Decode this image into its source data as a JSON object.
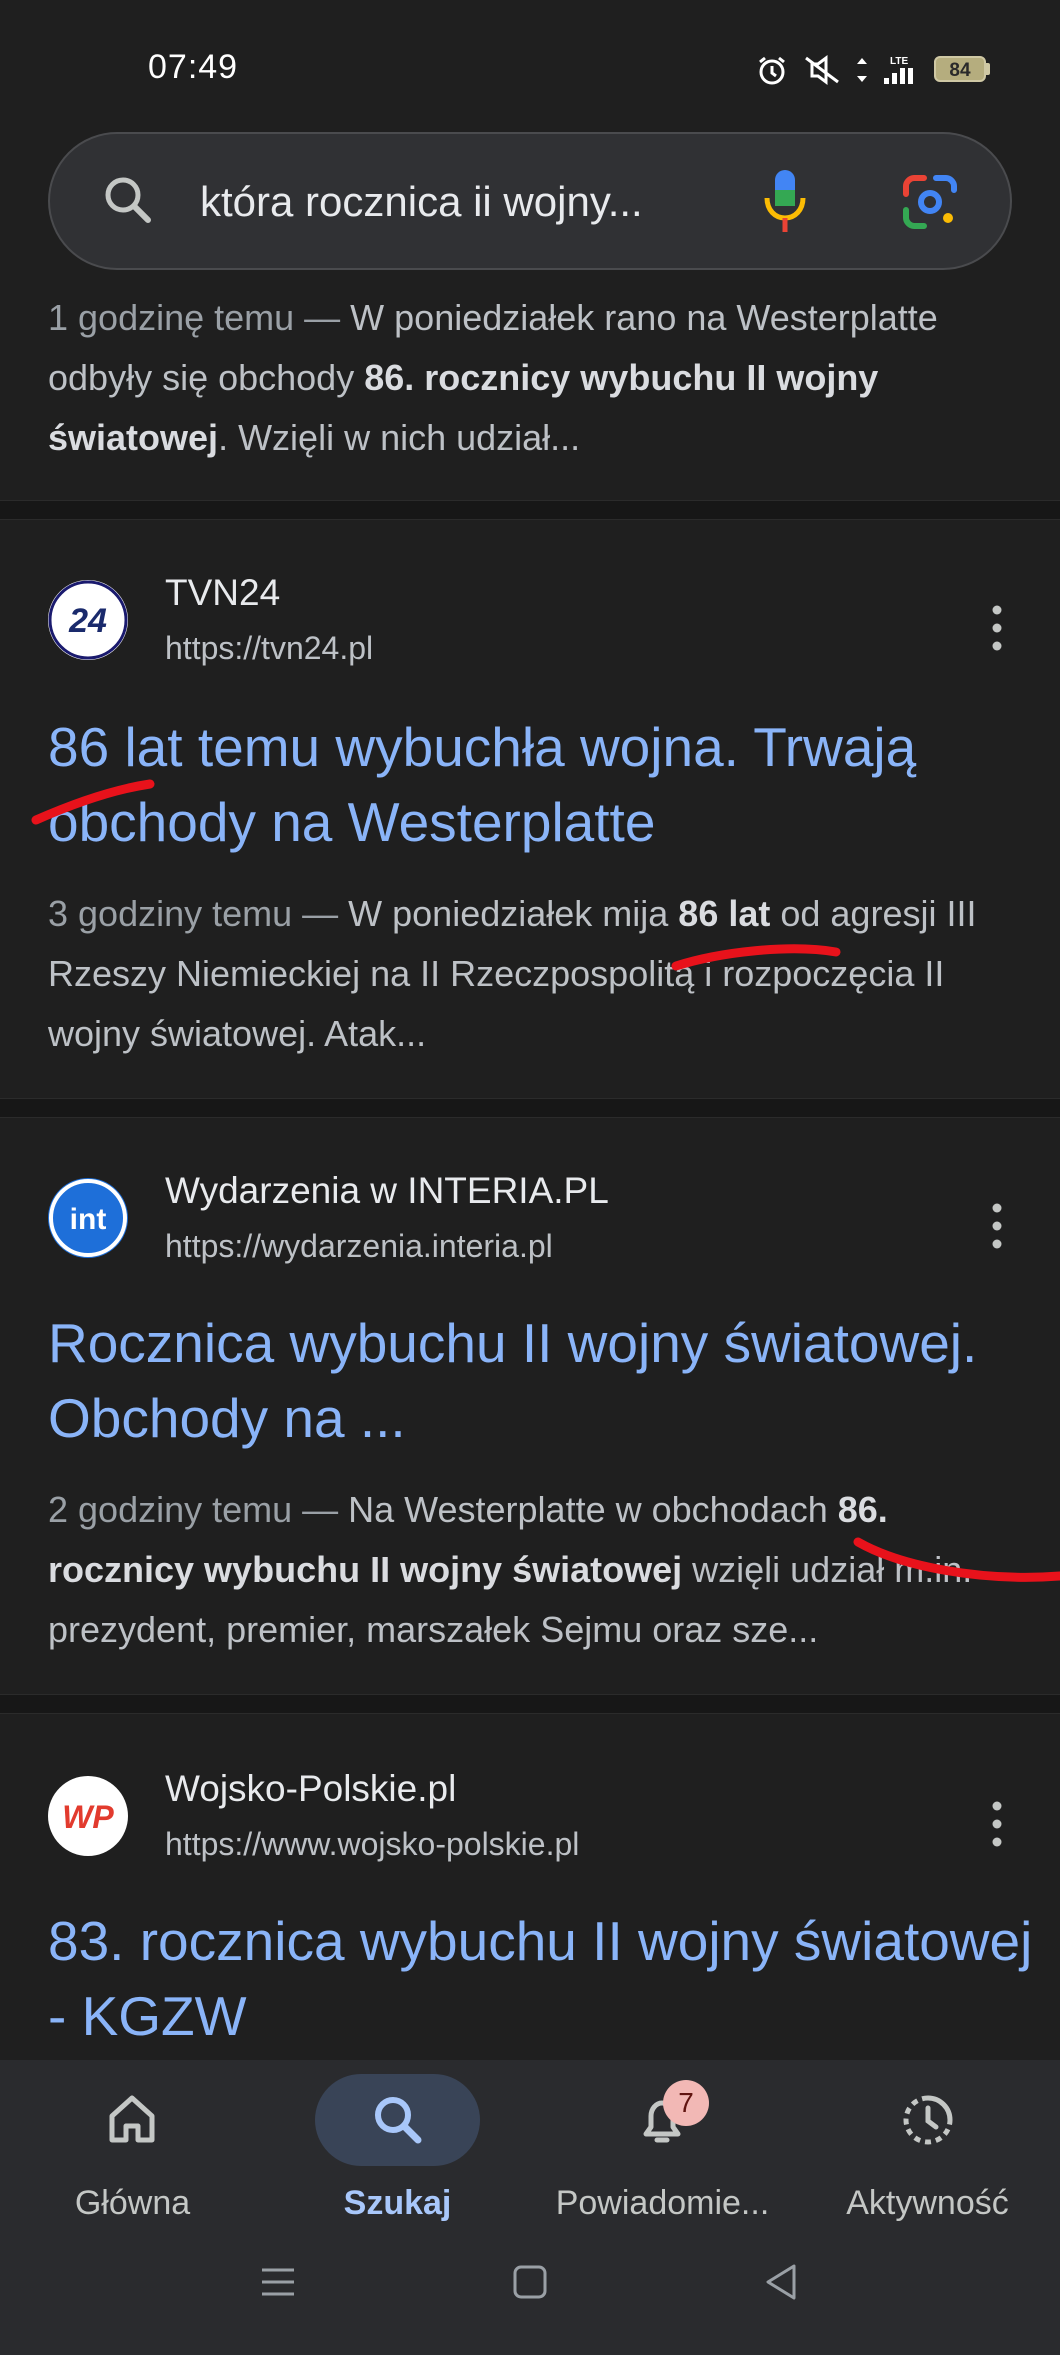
{
  "status_bar": {
    "time": "07:49",
    "battery": "84",
    "icons": [
      "alarm-icon",
      "mute-icon",
      "data-arrows-icon",
      "lte-signal-icon",
      "battery-icon"
    ]
  },
  "search": {
    "query": "która rocznica ii wojny...",
    "icons": [
      "search-icon",
      "mic-icon",
      "lens-icon"
    ]
  },
  "results": [
    {
      "snippet_meta": "1 godzinę temu — ",
      "snippet_a": "W poniedziałek rano na Westerplatte odbyły się obchody ",
      "snippet_bold": "86. rocznicy wybuchu II wojny światowej",
      "snippet_b": ". Wzięli w nich udział..."
    },
    {
      "site_name": "TVN24",
      "url": "https://tvn24.pl",
      "favicon_text": "24",
      "title": "86 lat temu wybuchła wojna. Trwają obchody na Westerplatte",
      "snippet_meta": "3 godziny temu — ",
      "snippet_a": "W poniedziałek mija ",
      "snippet_bold": "86 lat",
      "snippet_b": " od agresji III Rzeszy Niemieckiej na II Rzeczpospolitą i rozpoczęcia II wojny światowej. Atak..."
    },
    {
      "site_name": "Wydarzenia w INTERIA.PL",
      "url": "https://wydarzenia.interia.pl",
      "favicon_text": "int",
      "title": "Rocznica wybuchu II wojny światowej. Obchody na ...",
      "snippet_meta": "2 godziny temu — ",
      "snippet_a": "Na Westerplatte w obchodach ",
      "snippet_bold": "86. rocznicy wybuchu II wojny światowej",
      "snippet_b": " wzięli udział m.in. prezydent, premier, marszałek Sejmu oraz sze..."
    },
    {
      "site_name": "Wojsko-Polskie.pl",
      "url": "https://www.wojsko-polskie.pl",
      "favicon_text": "WP",
      "title": "83. rocznica wybuchu II wojny światowej - KGZW"
    }
  ],
  "bottom_nav": {
    "items": [
      {
        "label": "Główna",
        "icon": "home-icon"
      },
      {
        "label": "Szukaj",
        "icon": "search-icon"
      },
      {
        "label": "Powiadomie...",
        "icon": "bell-icon"
      },
      {
        "label": "Aktywność",
        "icon": "activity-icon"
      }
    ],
    "notification_count": "7",
    "active_index": 1
  },
  "system_nav": [
    "menu-icon",
    "home-square-icon",
    "back-icon"
  ],
  "colors": {
    "background": "#1f1f1f",
    "link": "#8ab4f8",
    "annotation_red": "#e8121b",
    "nav_active": "#a8c7fa"
  }
}
